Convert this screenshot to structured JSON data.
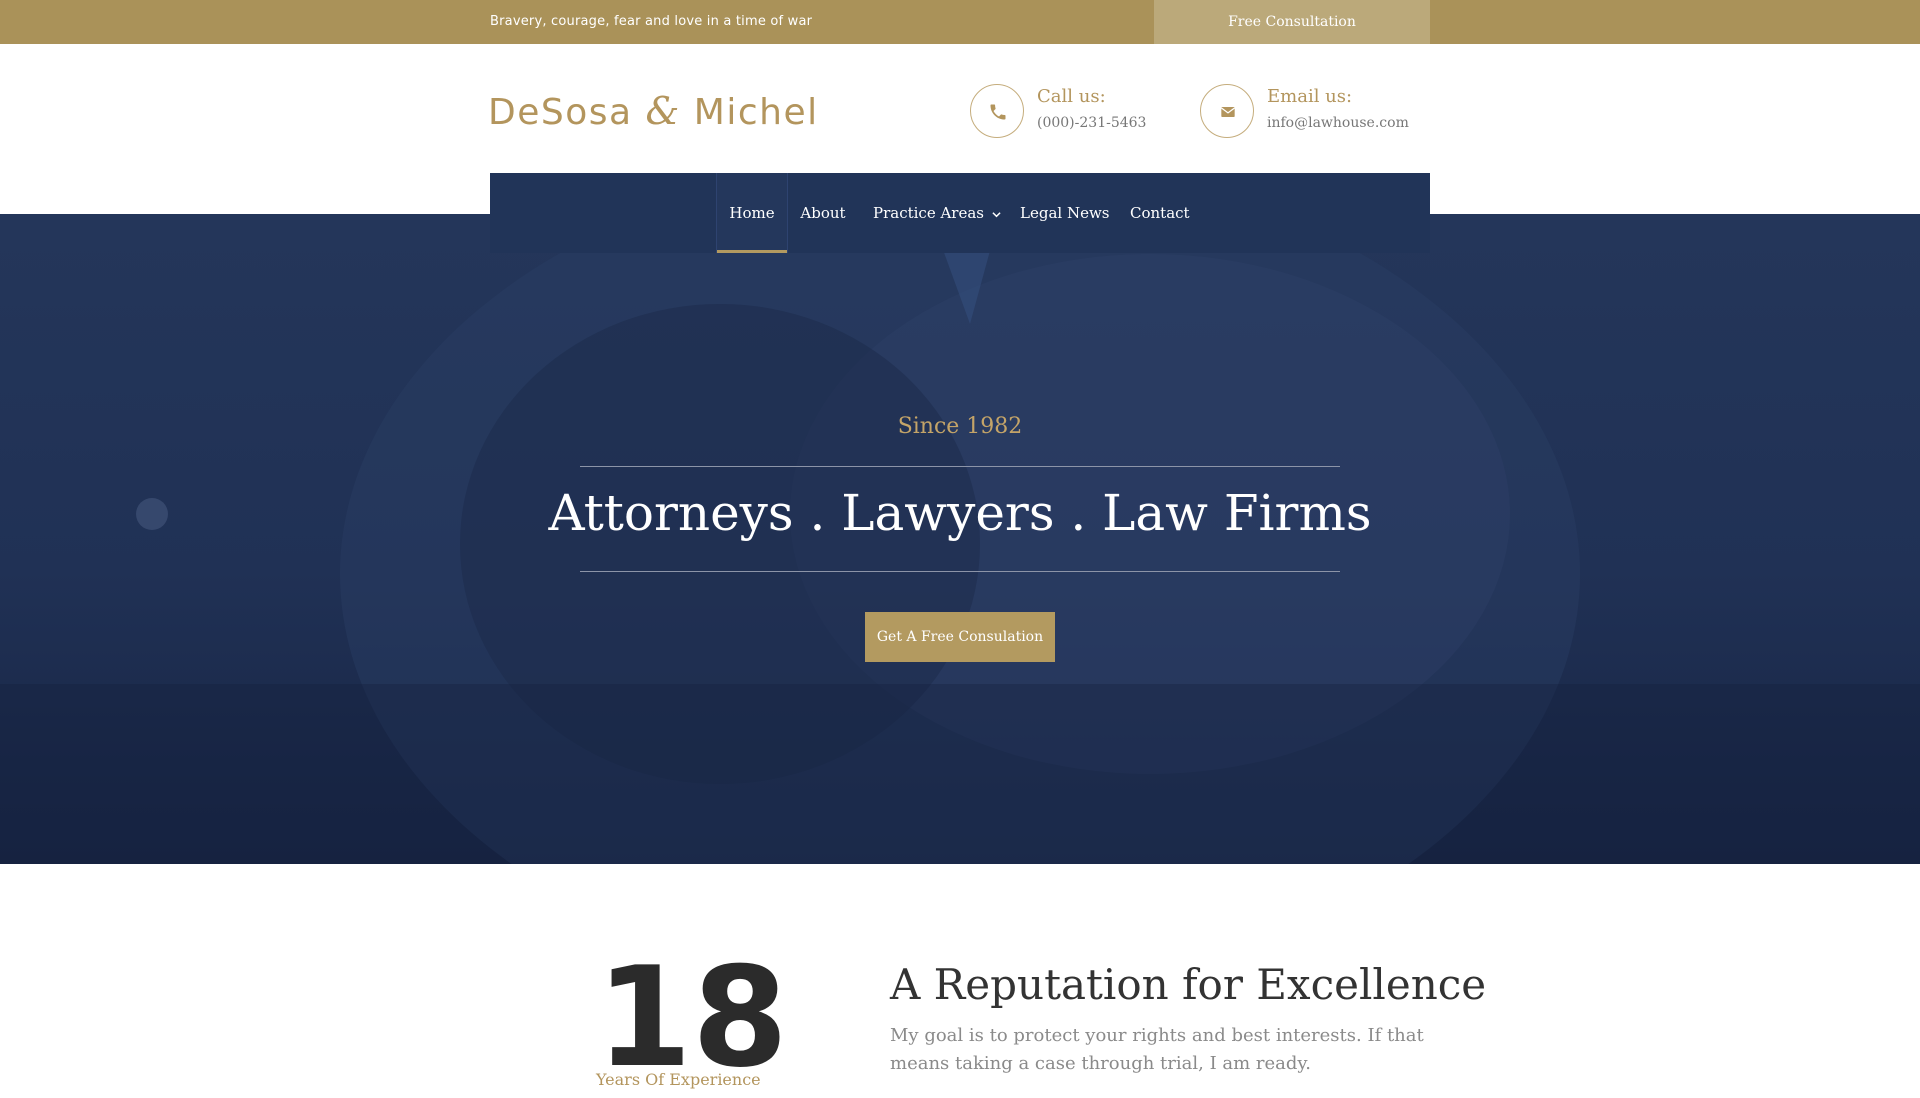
{
  "topbar": {
    "tagline": "Bravery, courage, fear and love in a time of war",
    "consult_label": "Free Consultation"
  },
  "header": {
    "logo_left": "DeSosa",
    "logo_amp": "&",
    "logo_right": "Michel",
    "call": {
      "label": "Call us:",
      "value": "(000)-231-5463",
      "icon": "phone-icon"
    },
    "email": {
      "label": "Email us:",
      "value": "info@lawhouse.com",
      "icon": "envelope-icon"
    }
  },
  "nav": {
    "items": [
      {
        "label": "Home",
        "active": true
      },
      {
        "label": "About"
      },
      {
        "label": "Practice Areas",
        "icon": "chevron-down-icon"
      },
      {
        "label": "Legal News"
      },
      {
        "label": "Contact"
      }
    ]
  },
  "hero": {
    "since": "Since 1982",
    "title": "Attorneys . Lawyers . Law Firms",
    "button_label": "Get A Free Consulation"
  },
  "about": {
    "number": "18",
    "number_label": "Years Of Experience",
    "title": "A Reputation for Excellence",
    "text": "My goal is to protect your rights and best interests. If that means taking a case through trial, I am ready."
  },
  "colors": {
    "gold": "#aa9259",
    "navy": "#213458",
    "hero_bg": "#1f3052"
  }
}
